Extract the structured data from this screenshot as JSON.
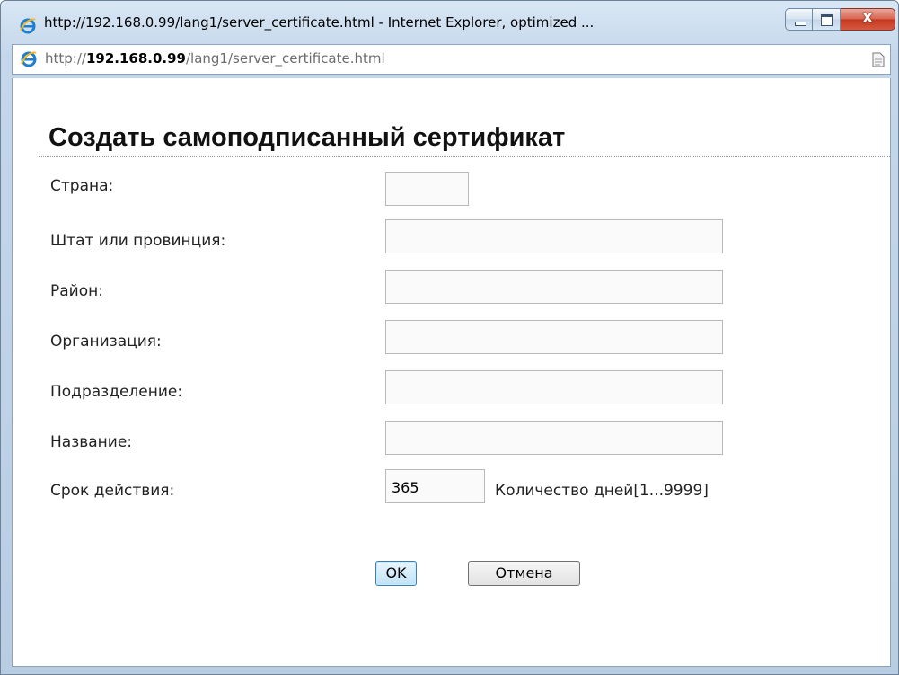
{
  "window": {
    "title": "http://192.168.0.99/lang1/server_certificate.html - Internet Explorer, optimized ...",
    "close_glyph": "X"
  },
  "address": {
    "prefix": "http://",
    "host": "192.168.0.99",
    "path": "/lang1/server_certificate.html"
  },
  "form": {
    "heading": "Создать самоподписанный сертификат",
    "fields": [
      {
        "label": "Страна:",
        "value": ""
      },
      {
        "label": "Штат или провинция:",
        "value": ""
      },
      {
        "label": "Район:",
        "value": ""
      },
      {
        "label": "Организация:",
        "value": ""
      },
      {
        "label": "Подразделение:",
        "value": ""
      },
      {
        "label": "Название:",
        "value": ""
      },
      {
        "label": "Срок действия:",
        "value": "365"
      }
    ],
    "validity_hint": "Количество дней[1...9999]",
    "ok_label": "OK",
    "cancel_label": "Отмена"
  },
  "icons": {
    "browser": "internet-explorer-icon",
    "page": "page-icon"
  },
  "colors": {
    "frame": "#c4d7ea",
    "close_button": "#c4381f",
    "ok_focus": "#3c7fb1"
  }
}
